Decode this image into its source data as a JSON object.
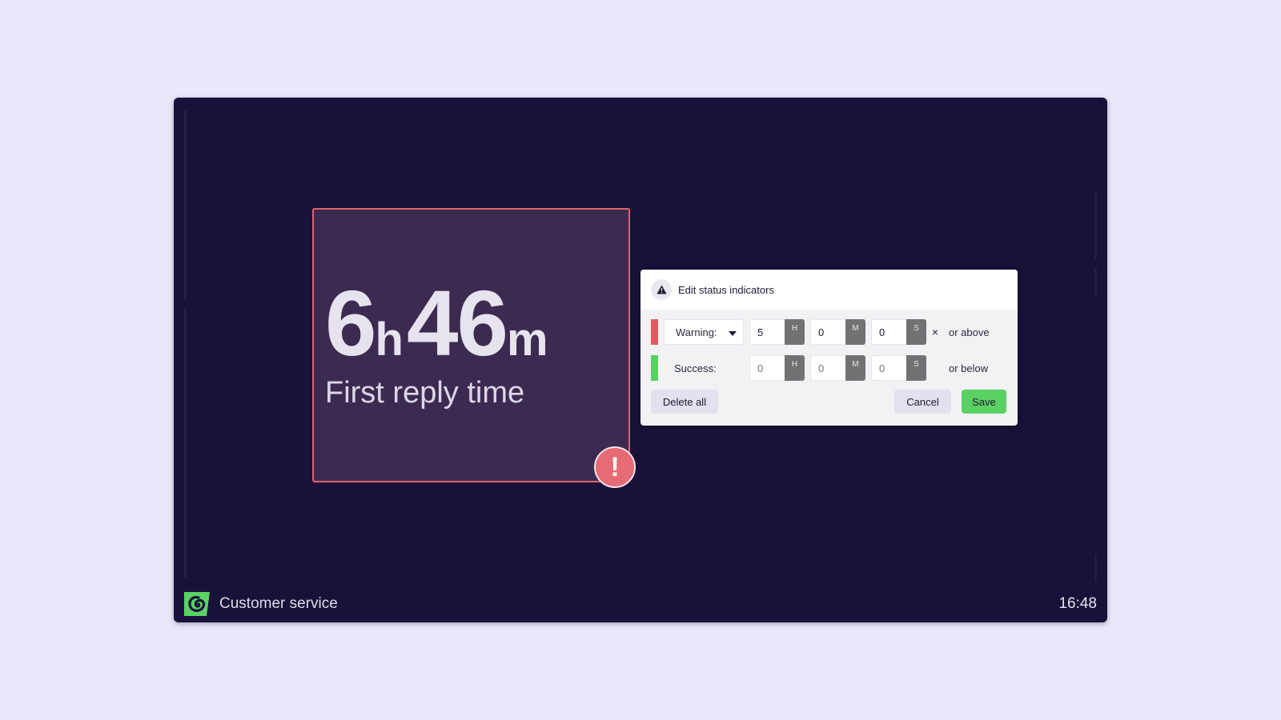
{
  "screen": {
    "background_color": "#18123a",
    "footer": {
      "title": "Customer service",
      "clock": "16:48",
      "logo_icon": "swirl-logo-icon",
      "logo_color": "#5bd164"
    }
  },
  "metric": {
    "hours_value": "6",
    "hours_unit": "h",
    "minutes_value": "46",
    "minutes_unit": "m",
    "label": "First reply time",
    "status": "warning",
    "status_color": "#e0636d",
    "alert_symbol": "!"
  },
  "dialog": {
    "title": "Edit status indicators",
    "header_icon": "warning-triangle-icon",
    "rows": [
      {
        "status": "Warning:",
        "color": "#e05a64",
        "has_dropdown": true,
        "hours": "5",
        "minutes": "0",
        "seconds": "0",
        "units": [
          "H",
          "M",
          "S"
        ],
        "clear_symbol": "×",
        "suffix": "or above"
      },
      {
        "status": "Success:",
        "color": "#5bd164",
        "has_dropdown": false,
        "hours_placeholder": "0",
        "minutes_placeholder": "0",
        "seconds_placeholder": "0",
        "units": [
          "H",
          "M",
          "S"
        ],
        "suffix": "or below"
      }
    ],
    "buttons": {
      "delete_all": "Delete all",
      "cancel": "Cancel",
      "save": "Save"
    }
  }
}
